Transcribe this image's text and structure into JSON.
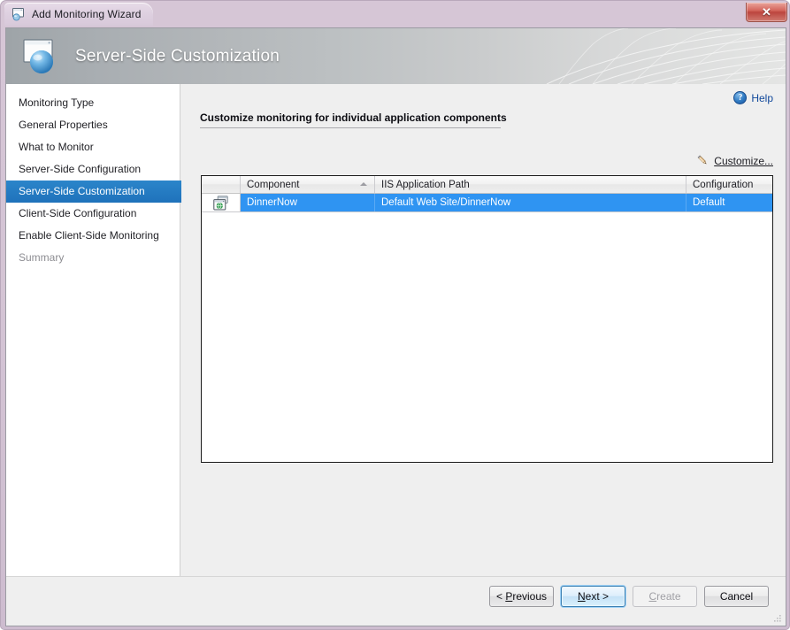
{
  "window": {
    "title": "Add Monitoring Wizard",
    "title_icon": "wizard-window-icon",
    "close_label": "✕"
  },
  "banner": {
    "title": "Server-Side Customization",
    "icon": "app-window-sphere-icon"
  },
  "sidebar": {
    "items": [
      {
        "label": "Monitoring Type",
        "state": "normal"
      },
      {
        "label": "General Properties",
        "state": "normal"
      },
      {
        "label": "What to Monitor",
        "state": "normal"
      },
      {
        "label": "Server-Side Configuration",
        "state": "normal"
      },
      {
        "label": "Server-Side Customization",
        "state": "active"
      },
      {
        "label": "Client-Side Configuration",
        "state": "normal"
      },
      {
        "label": "Enable Client-Side Monitoring",
        "state": "normal"
      },
      {
        "label": "Summary",
        "state": "disabled"
      }
    ]
  },
  "main": {
    "help_label": "Help",
    "help_icon": "help-question-icon",
    "heading": "Customize monitoring for individual application components",
    "customize_label": "Customize...",
    "customize_icon": "pencil-icon",
    "grid": {
      "columns": [
        {
          "label": "",
          "key": "icon"
        },
        {
          "label": "Component",
          "key": "component",
          "sort": "ascending"
        },
        {
          "label": "IIS Application Path",
          "key": "path"
        },
        {
          "label": "Configuration",
          "key": "configuration"
        }
      ],
      "rows": [
        {
          "icon": "web-application-icon",
          "component": "DinnerNow",
          "path": "Default Web Site/DinnerNow",
          "configuration": "Default",
          "selected": true
        }
      ]
    }
  },
  "footer": {
    "buttons": [
      {
        "label": "< Previous",
        "accel": "P",
        "state": "normal",
        "name": "previous-button"
      },
      {
        "label": "Next >",
        "accel": "N",
        "state": "default",
        "name": "next-button"
      },
      {
        "label": "Create",
        "accel": "C",
        "state": "disabled",
        "name": "create-button"
      },
      {
        "label": "Cancel",
        "accel": "",
        "state": "normal",
        "name": "cancel-button"
      }
    ]
  },
  "colors": {
    "accent_selection": "#2f94f2",
    "nav_active": "#2b85ca",
    "link": "#10489b",
    "close_button": "#bc453e"
  }
}
